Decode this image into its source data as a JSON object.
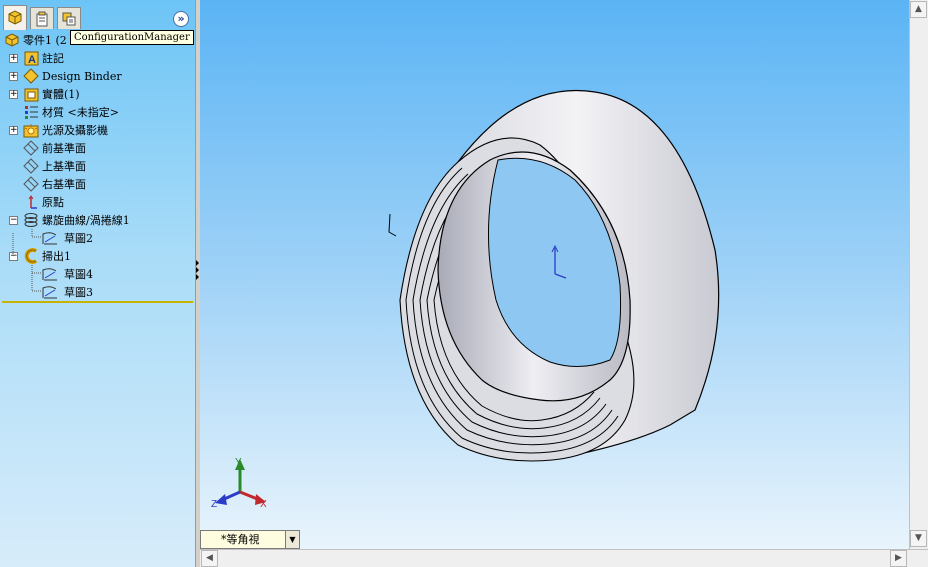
{
  "tabs": [
    {
      "name": "feature-manager",
      "icon": "feature-manager-icon"
    },
    {
      "name": "property-manager",
      "icon": "property-manager-icon"
    },
    {
      "name": "configuration-manager",
      "icon": "configuration-manager-icon"
    }
  ],
  "tooltip": "ConfigurationManager",
  "expand_glyph": "»",
  "tree": {
    "root_label": "零件1  (2",
    "items": [
      {
        "label": "註記",
        "icon": "annotations-icon",
        "toggle": "+"
      },
      {
        "label": "Design Binder",
        "icon": "design-binder-icon",
        "toggle": "+"
      },
      {
        "label": "實體(1)",
        "icon": "solid-bodies-icon",
        "toggle": "+"
      },
      {
        "label": "材質 <未指定>",
        "icon": "material-icon",
        "toggle": ""
      },
      {
        "label": "光源及攝影機",
        "icon": "lights-cameras-icon",
        "toggle": "+"
      },
      {
        "label": "前基準面",
        "icon": "plane-icon",
        "toggle": ""
      },
      {
        "label": "上基準面",
        "icon": "plane-icon",
        "toggle": ""
      },
      {
        "label": "右基準面",
        "icon": "plane-icon",
        "toggle": ""
      },
      {
        "label": "原點",
        "icon": "origin-icon",
        "toggle": ""
      },
      {
        "label": "螺旋曲線/渦捲線1",
        "icon": "helix-icon",
        "toggle": "−"
      },
      {
        "label": "草圖2",
        "icon": "sketch-icon",
        "toggle": ""
      },
      {
        "label": "掃出1",
        "icon": "sweep-icon",
        "toggle": "−"
      },
      {
        "label": "草圖4",
        "icon": "sketch-icon",
        "toggle": ""
      },
      {
        "label": "草圖3",
        "icon": "sketch-icon",
        "toggle": ""
      }
    ]
  },
  "view_orientation": "*等角視",
  "triad": {
    "x": "X",
    "y": "Y",
    "z": "Z"
  },
  "colors": {
    "x_axis": "#c0282d",
    "y_axis": "#2a8a2a",
    "z_axis": "#2a3cc8",
    "part": "#e8e8ec"
  }
}
